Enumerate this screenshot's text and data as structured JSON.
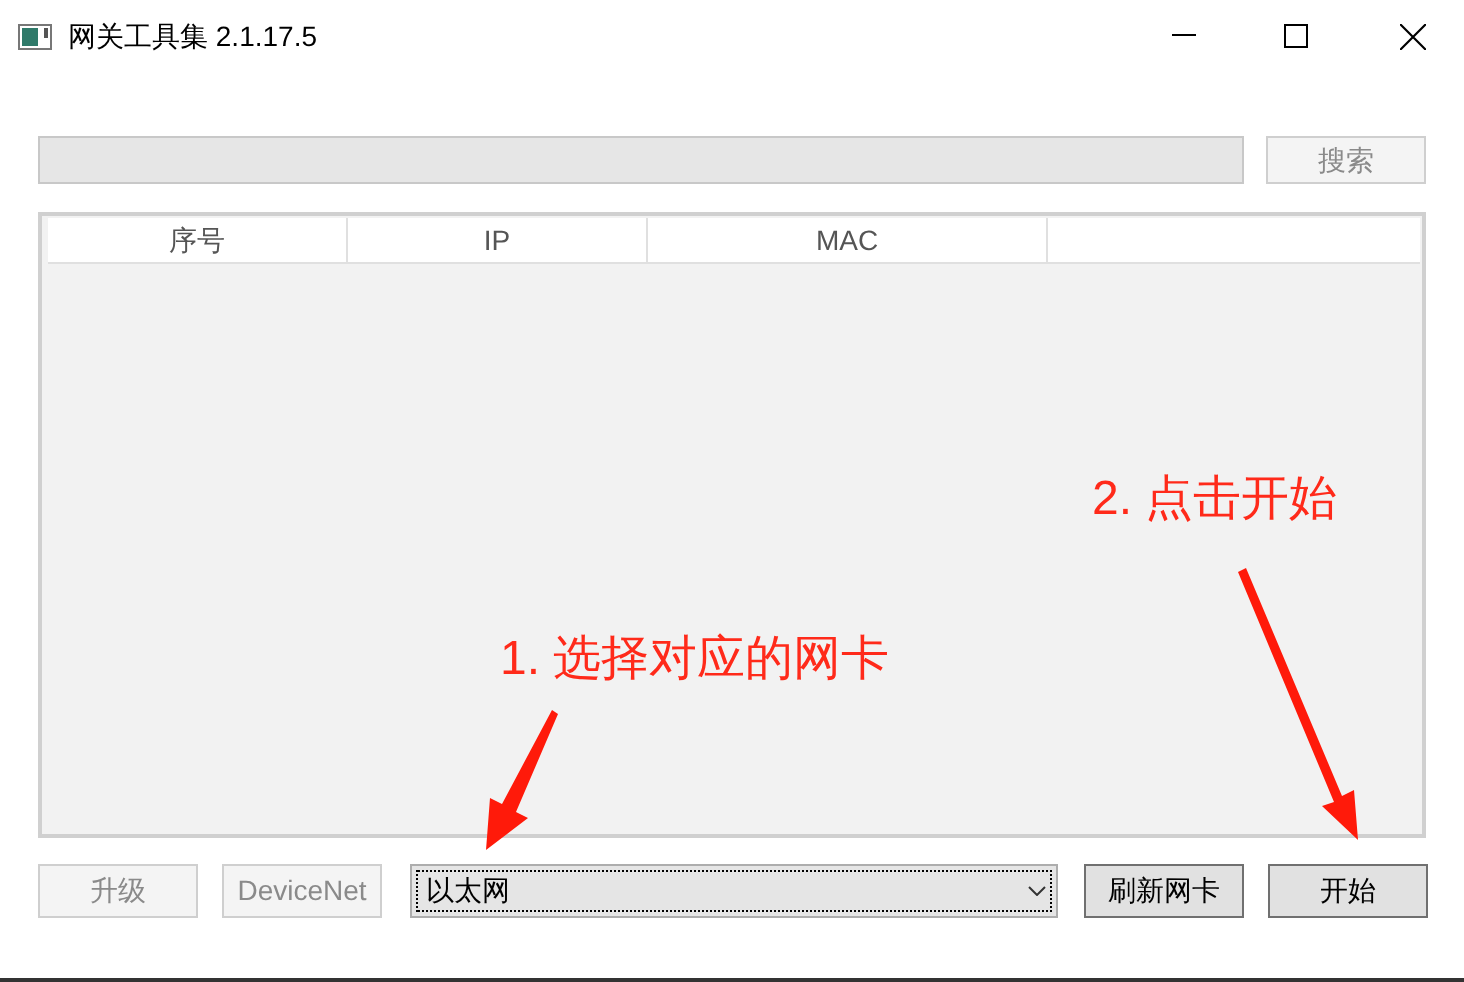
{
  "window": {
    "title": "网关工具集 2.1.17.5"
  },
  "search": {
    "disabled": true
  },
  "search_button": {
    "label": "搜索",
    "disabled": true
  },
  "table": {
    "columns": [
      "序号",
      "IP",
      "MAC"
    ]
  },
  "bottom_left_buttons": [
    {
      "label": "升级",
      "disabled": true
    },
    {
      "label": "DeviceNet",
      "disabled": true
    }
  ],
  "adapter_select": {
    "value": "以太网"
  },
  "bottom_right_buttons": [
    {
      "label": "刷新网卡",
      "disabled": false
    },
    {
      "label": "开始",
      "disabled": false
    }
  ],
  "annotations": [
    {
      "text": "1. 选择对应的网卡"
    },
    {
      "text": "2. 点击开始"
    }
  ]
}
